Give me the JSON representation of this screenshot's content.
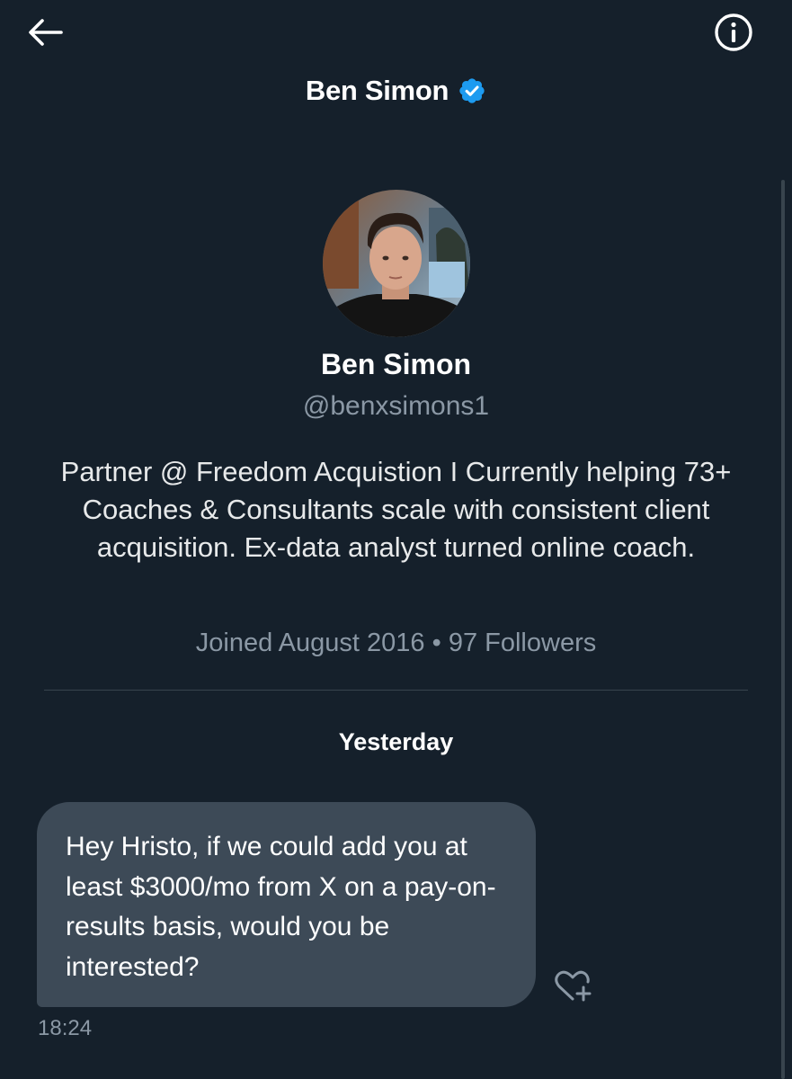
{
  "header": {
    "name": "Ben Simon",
    "back_icon": "arrow-left-icon",
    "info_icon": "info-circle-icon",
    "verified_icon": "verified-badge-icon",
    "verified_color": "#1d9bf0"
  },
  "profile": {
    "name": "Ben Simon",
    "handle": "@benxsimons1",
    "bio": "Partner @ Freedom Acquistion I Currently helping 73+ Coaches & Consultants scale with consistent client acquisition. Ex-data analyst turned online coach.",
    "joined": "Joined August 2016",
    "separator": "•",
    "followers": "97 Followers"
  },
  "conversation": {
    "date_separator": "Yesterday",
    "messages": [
      {
        "text": "Hey Hristo, if we could add you at least $3000/mo from X on a pay-on-results basis, would you be interested?",
        "time": "18:24",
        "reaction_icon": "add-reaction-heart-icon"
      }
    ]
  },
  "colors": {
    "background": "#15202b",
    "bubble": "#3d4a57",
    "muted_text": "#8b98a5",
    "divider": "#38444d"
  }
}
